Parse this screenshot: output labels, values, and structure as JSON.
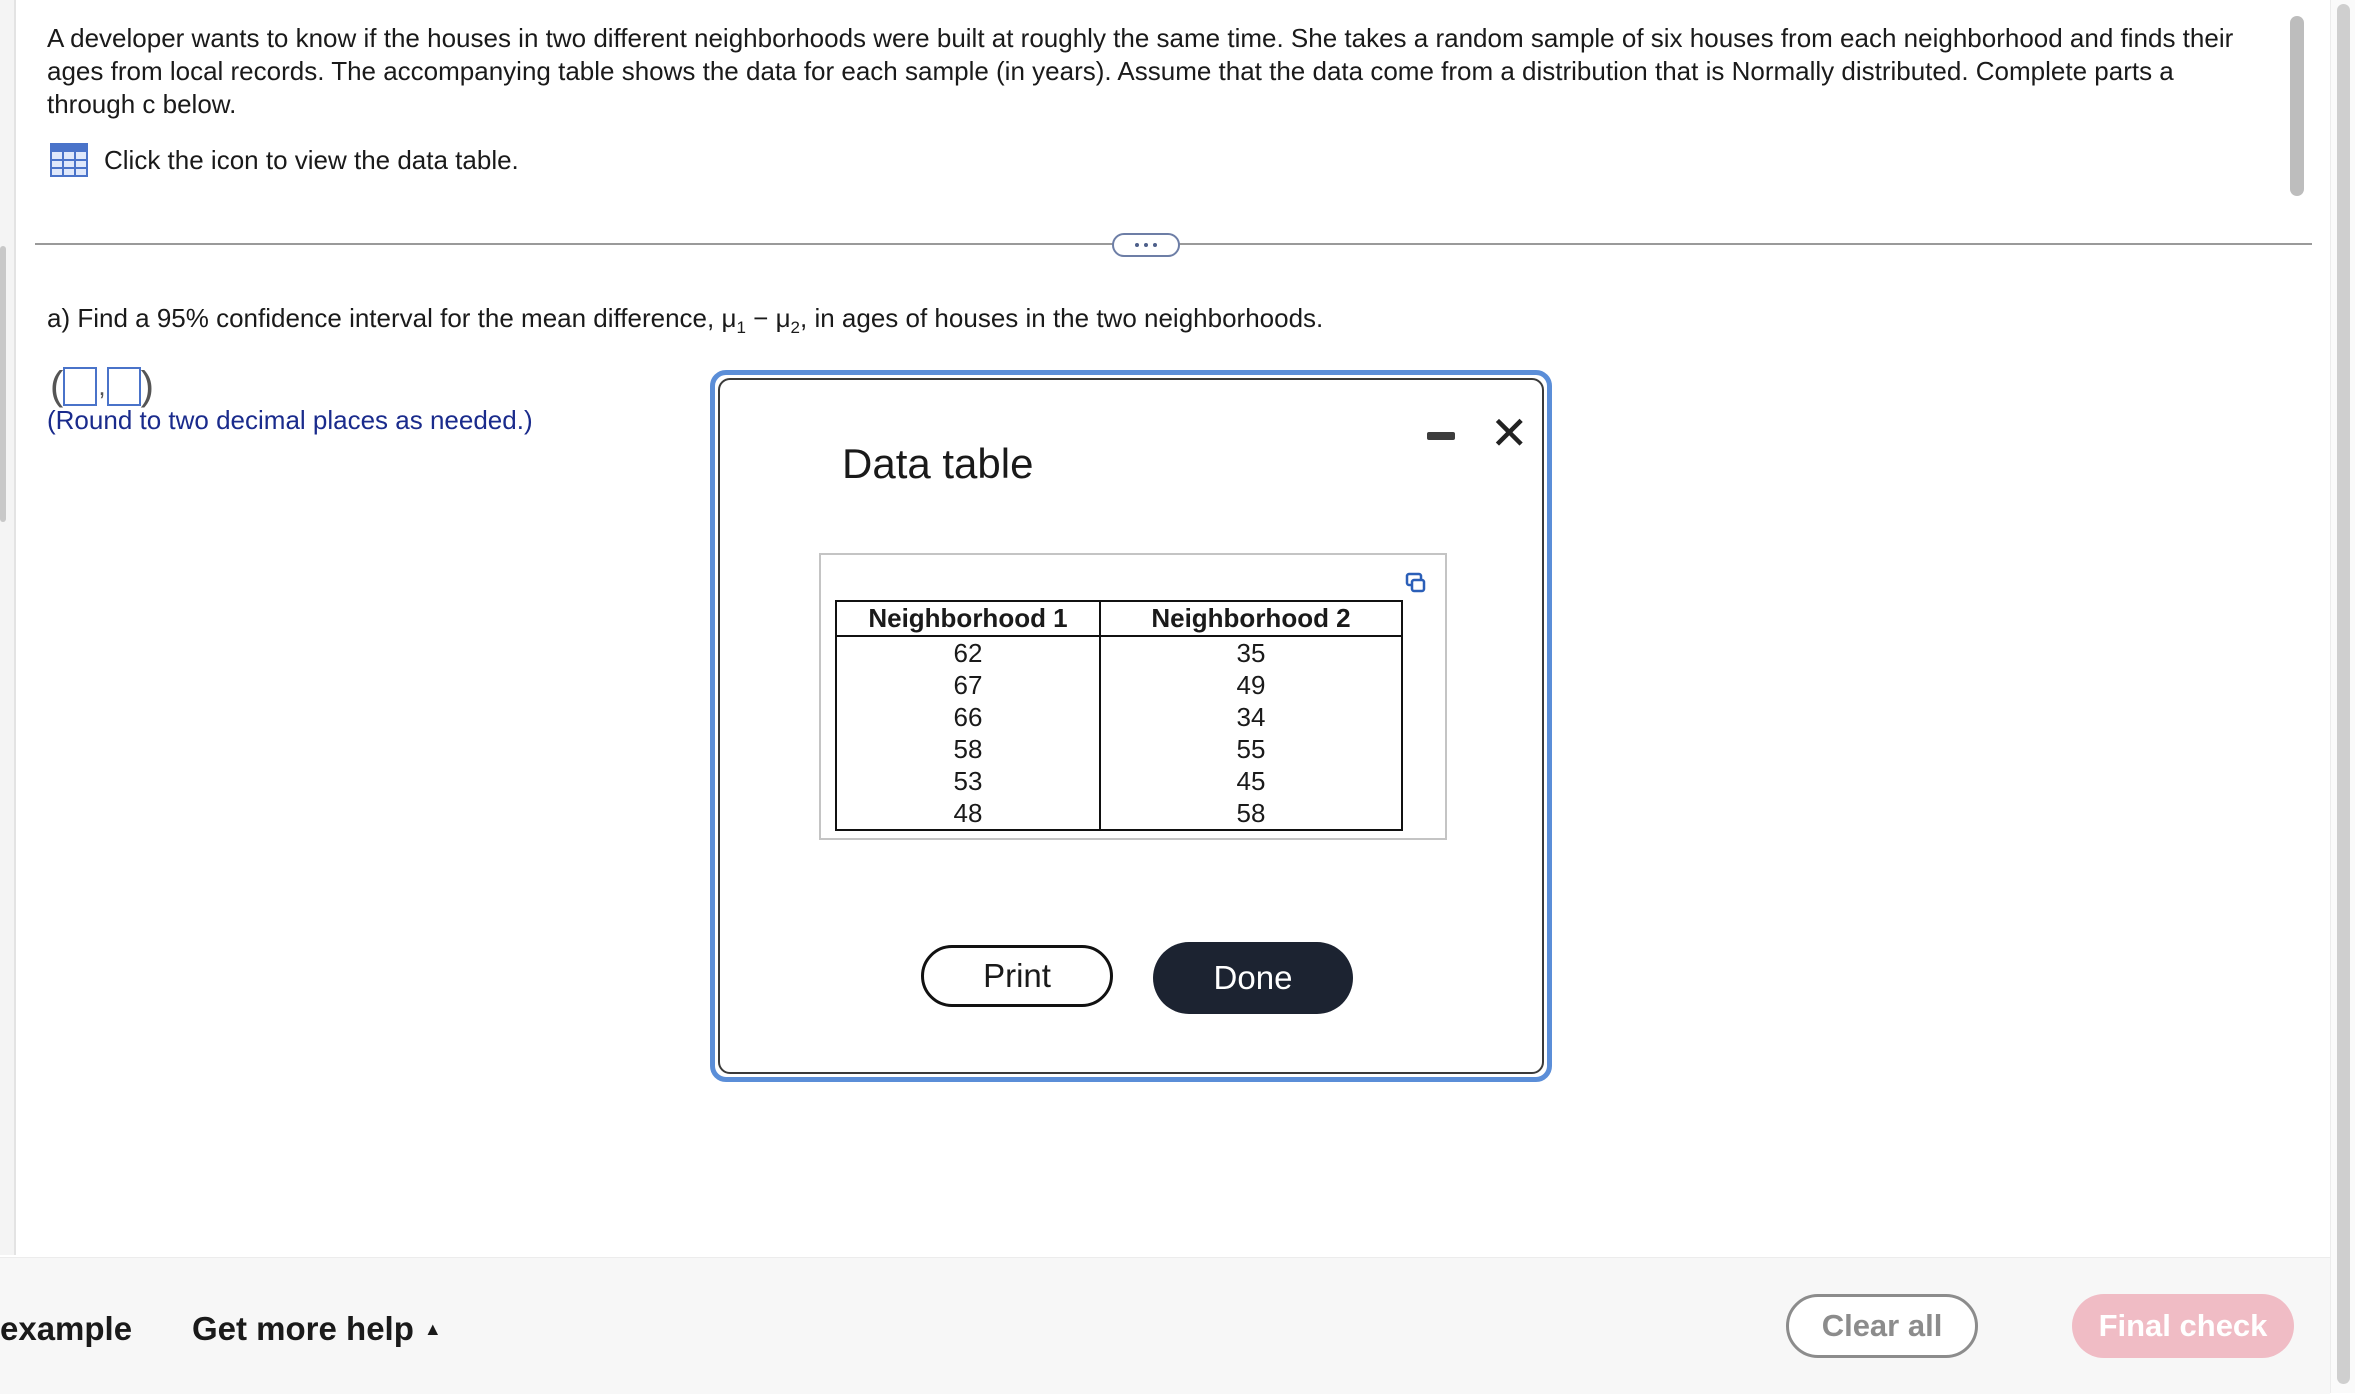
{
  "question": {
    "text": "A developer wants to know if the houses in two different neighborhoods were built at roughly the same time. She takes a random sample of six houses from each neighborhood and finds their ages from local records. The accompanying table shows the data for each sample (in years). Assume that the data come from a distribution that is Normally distributed. Complete parts a through c below.",
    "data_link_label": "Click the icon to view the data table."
  },
  "part_a": {
    "prefix": "a) Find a 95% confidence interval for the mean difference, ",
    "mu": "μ",
    "sub1": "1",
    "minus": " − ",
    "sub2": "2",
    "suffix": ", in ages of houses in the two neighborhoods.",
    "open_paren": "(",
    "comma": ",",
    "close_paren": ")",
    "hint": "(Round to two decimal places as needed.)"
  },
  "modal": {
    "title": "Data table",
    "close_glyph": "✕",
    "table": {
      "headers": [
        "Neighborhood 1",
        "Neighborhood 2"
      ],
      "rows": [
        [
          "62",
          "35"
        ],
        [
          "67",
          "49"
        ],
        [
          "66",
          "34"
        ],
        [
          "58",
          "55"
        ],
        [
          "53",
          "45"
        ],
        [
          "48",
          "58"
        ]
      ]
    },
    "print_label": "Print",
    "done_label": "Done"
  },
  "footer": {
    "example_label": "example",
    "help_label": "Get more help",
    "help_caret": "▲",
    "clear_label": "Clear all",
    "final_label": "Final check"
  },
  "colors": {
    "accent_blue": "#5b8ed8",
    "hint_navy": "#1a2b8c",
    "done_bg": "#1c2331",
    "final_check_bg": "#f0bcc5"
  }
}
